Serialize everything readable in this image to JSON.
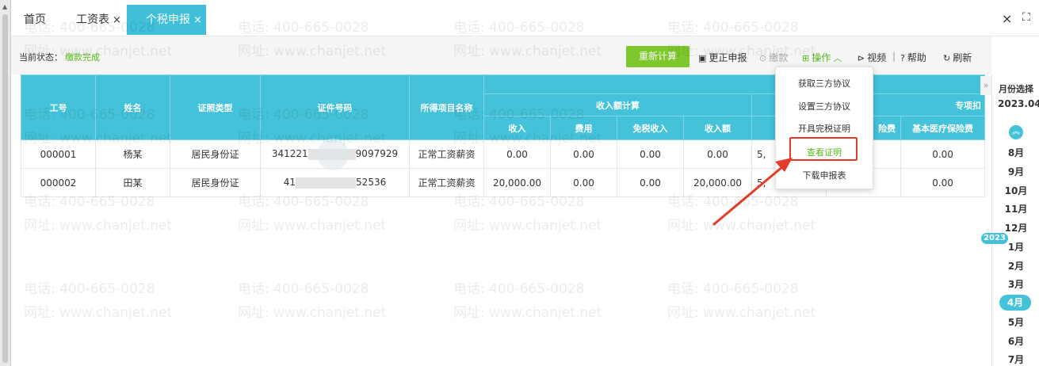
{
  "tabs": {
    "home": "首页",
    "salary": "工资表",
    "tax": "个税申报",
    "close": "×"
  },
  "window": {
    "close": "×",
    "fullscreen": "⛶"
  },
  "status": {
    "label": "当前状态：",
    "value": "缴款完成"
  },
  "toolbar": {
    "recalc": "重新计算",
    "correct": "更正申报",
    "pay": "缴款",
    "ops": "操作",
    "video": "视频",
    "sep": "|",
    "help": "帮助",
    "refresh": "刷新"
  },
  "table": {
    "headers": {
      "emp_no": "工号",
      "name": "姓名",
      "id_type": "证照类型",
      "id_no": "证件号码",
      "income_item": "所得项目名称",
      "income_group": "收入额计算",
      "income": "收入",
      "cost": "费用",
      "taxfree": "免税收入",
      "income_amount": "收入额",
      "deduct_group": "专项扣",
      "insurance": "险费",
      "medical": "基本医疗保险费"
    },
    "rows": [
      {
        "emp_no": "000001",
        "name": "杨某",
        "id_type": "居民身份证",
        "id_prefix": "341221",
        "id_suffix": "9097929",
        "income_item": "正常工资薪资",
        "income": "0.00",
        "cost": "0.00",
        "taxfree": "0.00",
        "income_amount": "0.00",
        "deduct_first": "5,",
        "medical": "0.00"
      },
      {
        "emp_no": "000002",
        "name": "田某",
        "id_type": "居民身份证",
        "id_prefix": "41",
        "id_suffix": "52536",
        "income_item": "正常工资薪资",
        "income": "20,000.00",
        "cost": "0.00",
        "taxfree": "0.00",
        "income_amount": "20,000.00",
        "deduct_first": "5,",
        "medical": "0.00"
      }
    ]
  },
  "dropdown": {
    "items": [
      "获取三方协议",
      "设置三方协议",
      "开具完税证明",
      "查看证明",
      "下载申报表"
    ]
  },
  "month_panel": {
    "title": "月份选择",
    "year": "2023.04",
    "up": "︽",
    "collapse": "»",
    "months_before": [
      "8月",
      "9月",
      "10月",
      "11月",
      "12月"
    ],
    "year_badge": "2023",
    "months_after": [
      "1月",
      "2月",
      "3月",
      "4月",
      "5月",
      "6月",
      "7月"
    ],
    "selected_month": "4月"
  },
  "watermark": {
    "phone": "电话: 400-665-0028",
    "site": "网址: www.chanjet.net"
  },
  "colors": {
    "accent": "#43c2d9",
    "green": "#7cc72b",
    "highlight_box": "#e53b2b"
  },
  "icons": {
    "correct": "doc-icon",
    "pay": "pay-icon",
    "ops": "grid-icon",
    "video": "play-icon",
    "help": "help-icon",
    "refresh": "refresh-icon"
  }
}
